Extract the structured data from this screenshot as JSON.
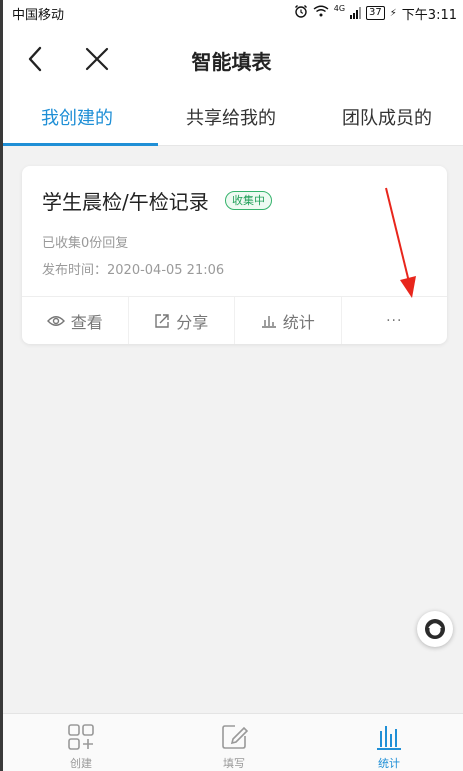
{
  "status_bar": {
    "carrier": "中国移动",
    "network": "4G",
    "battery": "37",
    "time": "下午3:11"
  },
  "header": {
    "title": "智能填表"
  },
  "tabs": [
    {
      "label": "我创建的",
      "active": true
    },
    {
      "label": "共享给我的",
      "active": false
    },
    {
      "label": "团队成员的",
      "active": false
    }
  ],
  "card": {
    "title": "学生晨检/午检记录",
    "badge": "收集中",
    "responses": "已收集0份回复",
    "publish_time": "发布时间：2020-04-05 21:06",
    "actions": {
      "view": "查看",
      "share": "分享",
      "stats": "统计",
      "more": "···"
    }
  },
  "bottom_nav": [
    {
      "label": "创建",
      "icon": "grid-plus-icon",
      "active": false
    },
    {
      "label": "填写",
      "icon": "edit-icon",
      "active": false
    },
    {
      "label": "统计",
      "icon": "bar-chart-icon",
      "active": true
    }
  ],
  "colors": {
    "accent": "#1f8fd6",
    "badge_green": "#22a05a",
    "annotation_red": "#e8261c"
  }
}
